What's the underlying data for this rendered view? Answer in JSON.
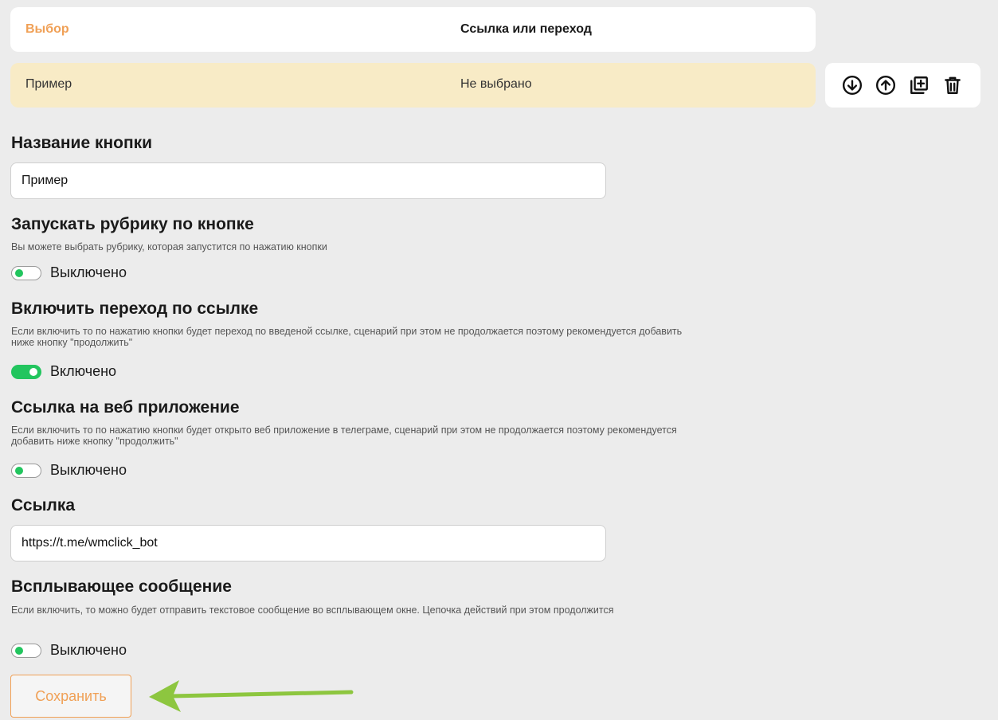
{
  "table": {
    "header": {
      "col1": "Выбор",
      "col2": "Ссылка или переход"
    },
    "row": {
      "col1": "Пример",
      "col2": "Не выбрано"
    },
    "actions": [
      "arrow-down-circle-icon",
      "arrow-up-circle-icon",
      "add-copy-icon",
      "trash-icon"
    ]
  },
  "button_name": {
    "title": "Название кнопки",
    "value": "Пример"
  },
  "rubric": {
    "title": "Запускать рубрику по кнопке",
    "hint": "Вы можете выбрать рубрику, которая запустится по нажатию кнопки",
    "state_label": "Выключено"
  },
  "link_jump": {
    "title": "Включить переход по ссылке",
    "hint": "Если включить то по нажатию кнопки будет переход по введеной ссылке, сценарий при этом не продолжается поэтому рекомендуется добавить ниже кнопку \"продолжить\"",
    "state_label": "Включено"
  },
  "web_app": {
    "title": "Ссылка на веб приложение",
    "hint": "Если включить то по нажатию кнопки будет открыто веб приложение в телеграме, сценарий при этом не продолжается поэтому рекомендуется добавить ниже кнопку \"продолжить\"",
    "state_label": "Выключено"
  },
  "link": {
    "title": "Ссылка",
    "value": "https://t.me/wmclick_bot"
  },
  "popup": {
    "title": "Всплывающее сообщение",
    "hint": "Если включить, то можно будет отправить текстовое сообщение во всплывающем окне. Цепочка действий при этом продолжится",
    "state_label": "Выключено"
  },
  "save_label": "Сохранить",
  "colors": {
    "accent": "#f0a056",
    "toggle_on": "#22c55e",
    "row_highlight": "#f8ebc6",
    "arrow": "#8dc63f"
  }
}
